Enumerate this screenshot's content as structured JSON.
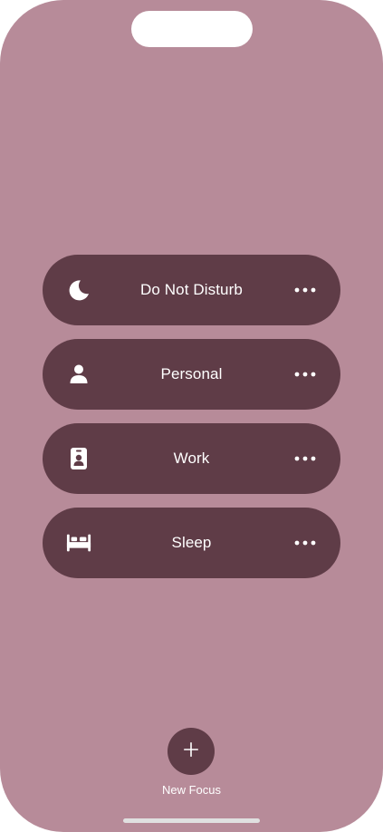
{
  "focus_modes": [
    {
      "label": "Do Not Disturb",
      "icon": "moon-icon"
    },
    {
      "label": "Personal",
      "icon": "person-icon"
    },
    {
      "label": "Work",
      "icon": "id-badge-icon"
    },
    {
      "label": "Sleep",
      "icon": "bed-icon"
    }
  ],
  "new_focus": {
    "label": "New Focus",
    "icon": "plus-icon"
  },
  "colors": {
    "background": "#b78b99",
    "pill": "#5f3c47",
    "text": "#ffffff"
  }
}
